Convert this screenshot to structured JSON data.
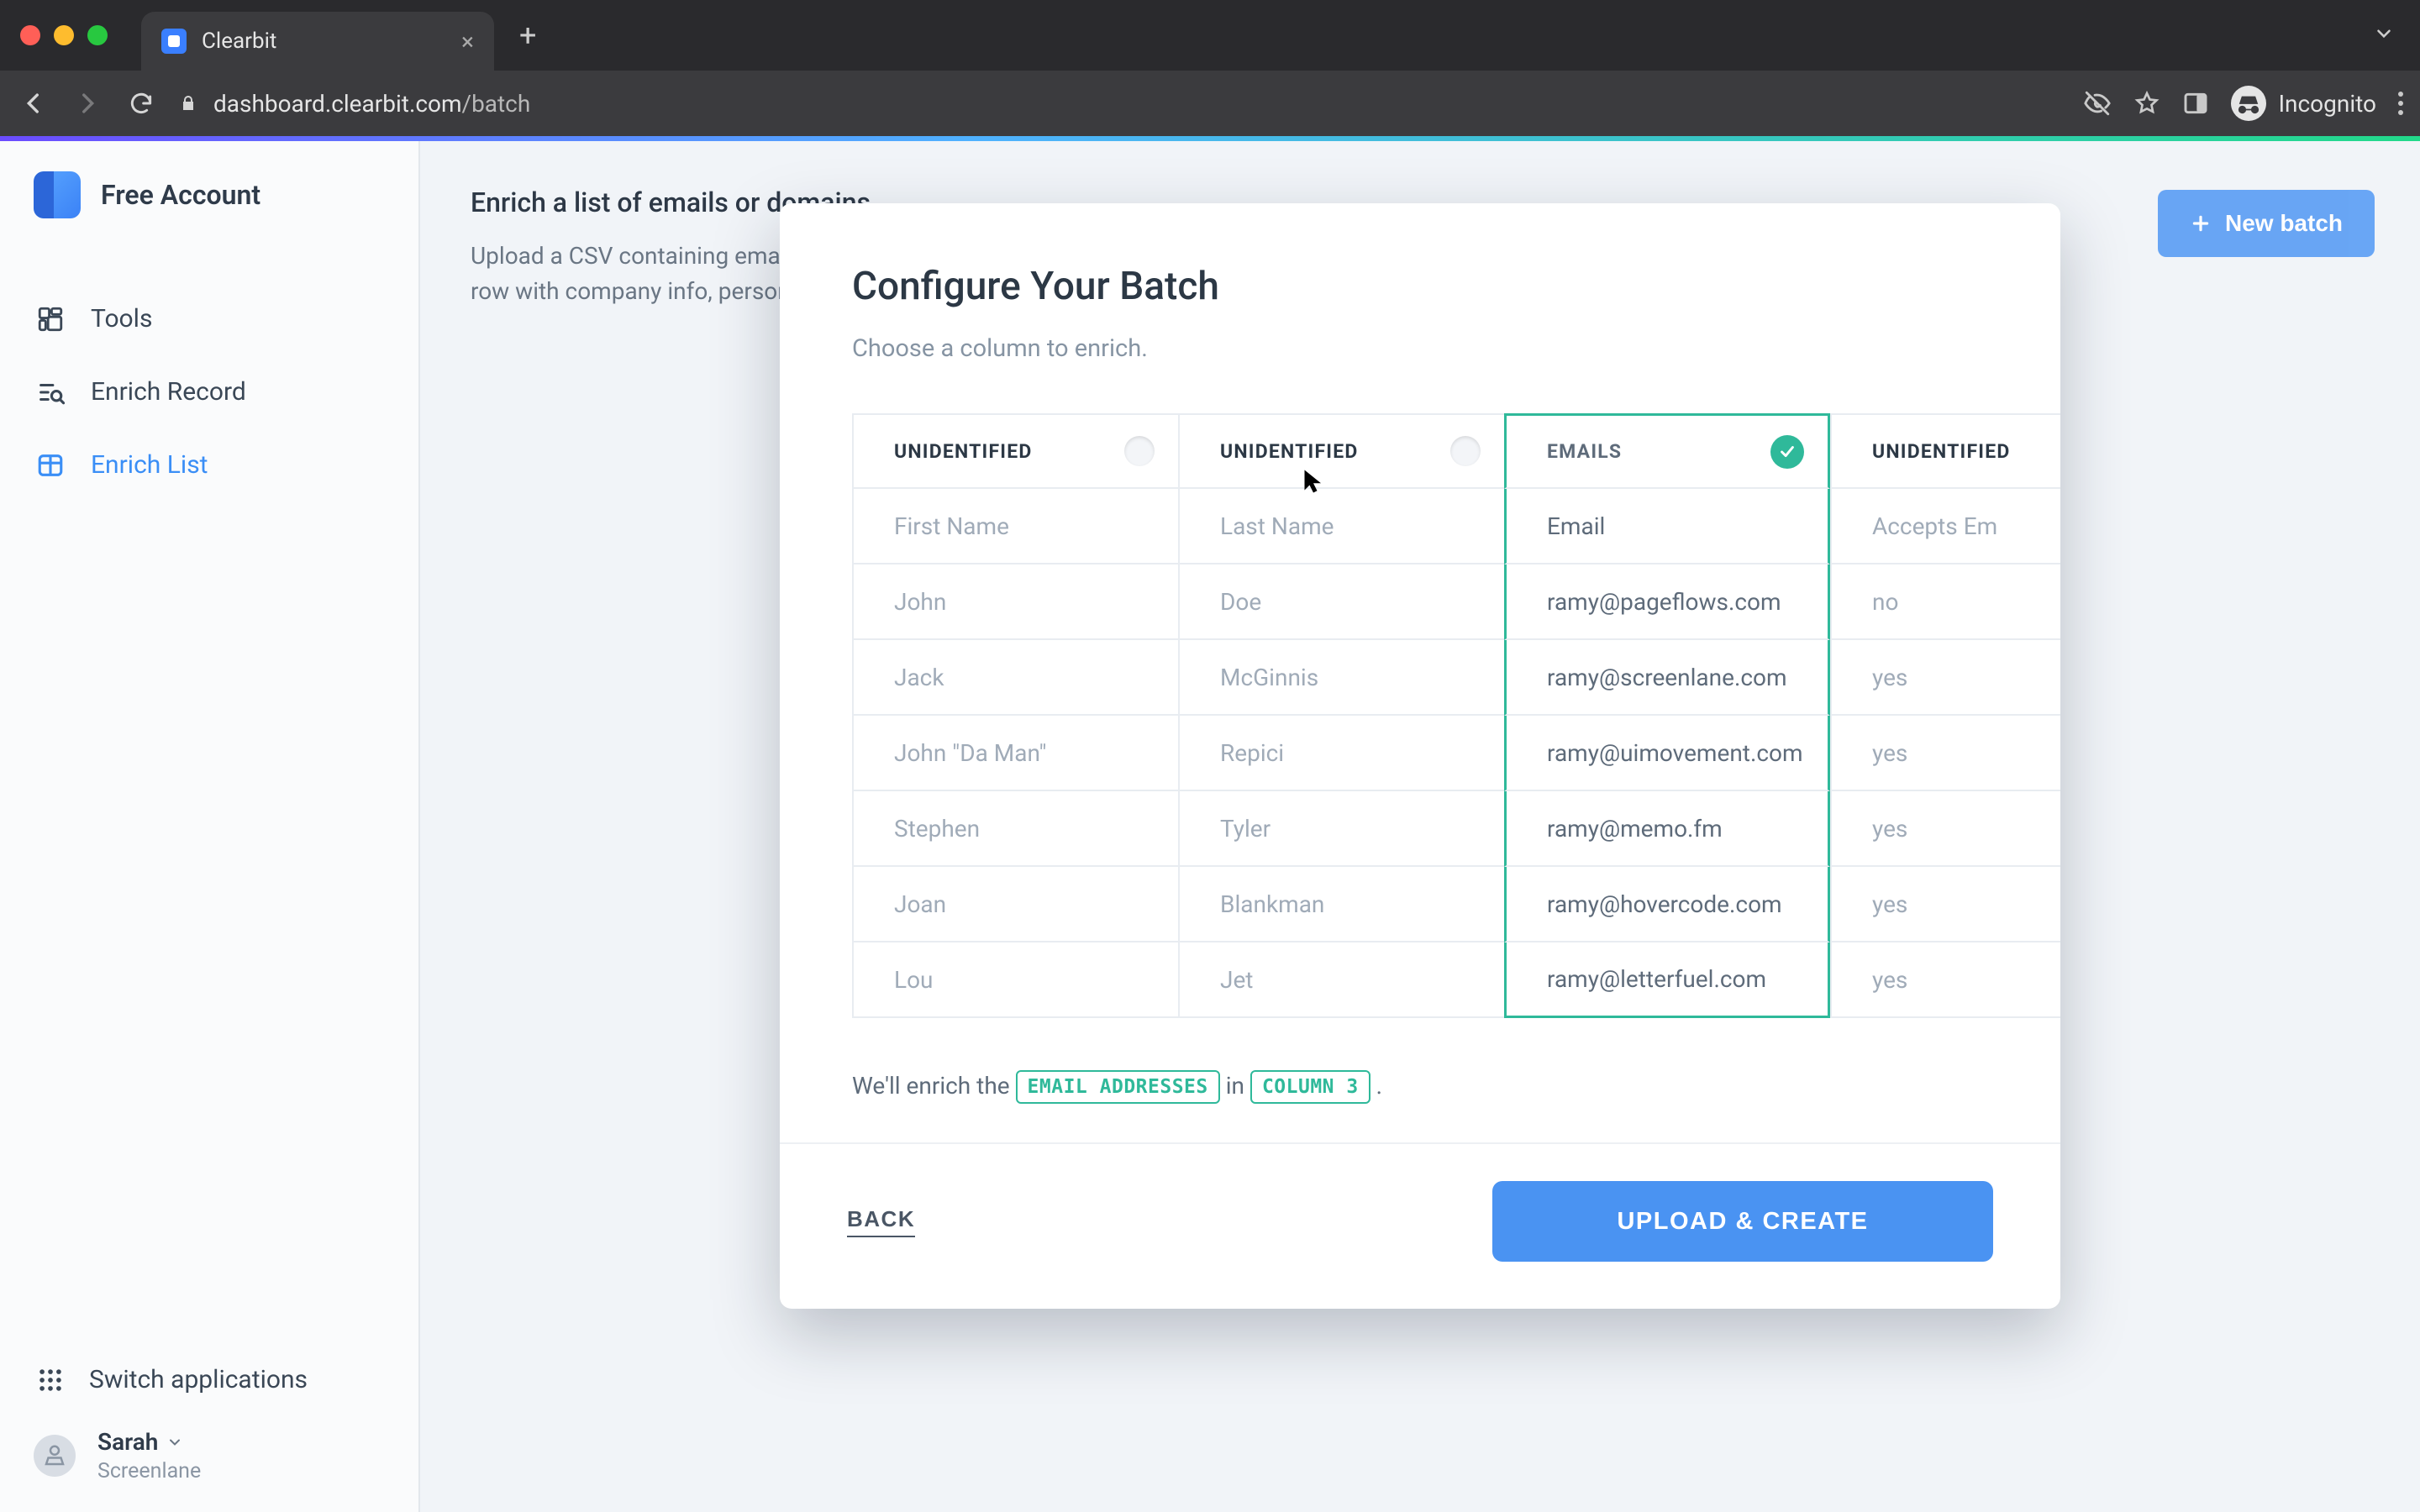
{
  "browser": {
    "tab_title": "Clearbit",
    "url_host": "dashboard.clearbit.com",
    "url_path": "/batch",
    "incognito_label": "Incognito"
  },
  "sidebar": {
    "account_label": "Free Account",
    "items": [
      {
        "label": "Tools"
      },
      {
        "label": "Enrich Record"
      },
      {
        "label": "Enrich List"
      }
    ],
    "switch_label": "Switch applications",
    "user_name": "Sarah",
    "user_org": "Screenlane"
  },
  "page": {
    "heading": "Enrich a list of emails or domains",
    "desc_line": "Upload a CSV containing emails or domains and enrich each row with company info, person info, p…",
    "new_batch": "New batch"
  },
  "modal": {
    "title": "Configure Your Batch",
    "subtitle": "Choose a column to enrich.",
    "columns": [
      {
        "header": "UNIDENTIFIED",
        "selected": false
      },
      {
        "header": "UNIDENTIFIED",
        "selected": false
      },
      {
        "header": "EMAILS",
        "selected": true
      },
      {
        "header": "UNIDENTIFIED",
        "selected": false
      }
    ],
    "rows": [
      [
        "First Name",
        "Last Name",
        "Email",
        "Accepts Em"
      ],
      [
        "John",
        "Doe",
        "ramy@pageflows.com",
        "no"
      ],
      [
        "Jack",
        "McGinnis",
        "ramy@screenlane.com",
        "yes"
      ],
      [
        "John \"Da Man\"",
        "Repici",
        "ramy@uimovement.com",
        "yes"
      ],
      [
        "Stephen",
        "Tyler",
        "ramy@memo.fm",
        "yes"
      ],
      [
        "Joan",
        "Blankman",
        "ramy@hovercode.com",
        "yes"
      ],
      [
        "Lou",
        "Jet",
        "ramy@letterfuel.com",
        "yes"
      ]
    ],
    "enrich_prefix": "We'll enrich the ",
    "enrich_badge1": "EMAIL ADDRESSES",
    "enrich_mid": " in ",
    "enrich_badge2": "COLUMN 3",
    "back": "BACK",
    "upload": "UPLOAD & CREATE"
  }
}
